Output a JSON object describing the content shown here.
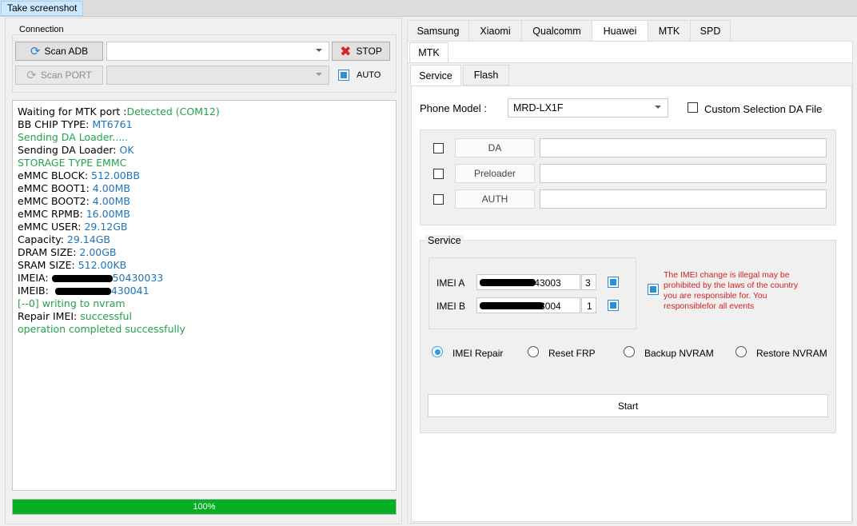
{
  "menubar": {
    "screenshot_button": "Take screenshot"
  },
  "connection": {
    "title": "Connection",
    "scan_adb": "Scan ADB",
    "stop": "STOP",
    "scan_port": "Scan PORT",
    "auto_label": "AUTO"
  },
  "log": [
    [
      {
        "t": "Waiting for MTK port :",
        "c": ""
      },
      {
        "t": "Detected (COM12)",
        "c": "green"
      }
    ],
    [
      {
        "t": "BB CHIP TYPE: ",
        "c": ""
      },
      {
        "t": "MT6761",
        "c": "blue"
      }
    ],
    [
      {
        "t": "Sending DA Loader.....",
        "c": "green"
      }
    ],
    [
      {
        "t": "Sending DA Loader: ",
        "c": ""
      },
      {
        "t": "OK",
        "c": "blue"
      }
    ],
    [
      {
        "t": "STORAGE TYPE EMMC",
        "c": "green"
      }
    ],
    [
      {
        "t": "eMMC BLOCK: ",
        "c": ""
      },
      {
        "t": "512.00BB",
        "c": "blue"
      }
    ],
    [
      {
        "t": "eMMC BOOT1: ",
        "c": ""
      },
      {
        "t": "4.00MB",
        "c": "blue"
      }
    ],
    [
      {
        "t": "eMMC BOOT2: ",
        "c": ""
      },
      {
        "t": "4.00MB",
        "c": "blue"
      }
    ],
    [
      {
        "t": "eMMC RPMB: ",
        "c": ""
      },
      {
        "t": "16.00MB",
        "c": "blue"
      }
    ],
    [
      {
        "t": "eMMC USER: ",
        "c": ""
      },
      {
        "t": "29.12GB",
        "c": "blue"
      }
    ],
    [
      {
        "t": "Capacity: ",
        "c": ""
      },
      {
        "t": "29.14GB",
        "c": "blue"
      }
    ],
    [
      {
        "t": "DRAM SIZE: ",
        "c": ""
      },
      {
        "t": "2.00GB",
        "c": "blue"
      }
    ],
    [
      {
        "t": "SRAM SIZE: ",
        "c": ""
      },
      {
        "t": "512.00KB",
        "c": "blue"
      }
    ],
    [
      {
        "t": "IMEIA:",
        "c": ""
      },
      {
        "t": "",
        "c": "redact"
      },
      {
        "t": "50430033",
        "c": "blue"
      }
    ],
    [
      {
        "t": "IMEIB: ",
        "c": ""
      },
      {
        "t": "",
        "c": "redact"
      },
      {
        "t": "430041",
        "c": "blue"
      }
    ],
    [
      {
        "t": "[--0] writing to nvram",
        "c": "green"
      }
    ],
    [
      {
        "t": "Repair IMEI: ",
        "c": ""
      },
      {
        "t": "successful",
        "c": "green"
      }
    ],
    [
      {
        "t": "operation completed successfully",
        "c": "green"
      }
    ]
  ],
  "progress": {
    "label": "100%",
    "value": 100
  },
  "brand_tabs": [
    "Samsung",
    "Xiaomi",
    "Qualcomm",
    "Huawei",
    "MTK",
    "SPD"
  ],
  "sub_tab": "MTK",
  "mode_tabs": [
    "Service",
    "Flash"
  ],
  "phone_model": {
    "label": "Phone Model :",
    "value": "MRD-LX1F"
  },
  "custom_da": {
    "label": "Custom Selection DA File"
  },
  "da_files": [
    {
      "button": "DA",
      "path": ""
    },
    {
      "button": "Preloader",
      "path": ""
    },
    {
      "button": "AUTH",
      "path": ""
    }
  ],
  "service": {
    "title": "Service",
    "imei_a": {
      "label": "IMEI A",
      "value": "5043003",
      "check_digit": "3"
    },
    "imei_b": {
      "label": "IMEI B",
      "value": "5043004",
      "check_digit": "1"
    },
    "warning": "The IMEI change is illegal may be prohibited by the laws of the country you are responsible for. You responsiblefor all events",
    "options": [
      "IMEI Repair",
      "Reset FRP",
      "Backup NVRAM",
      "Restore NVRAM"
    ],
    "selected_option": "IMEI Repair",
    "start": "Start"
  },
  "colors": {
    "accent": "#2b8fd8",
    "success": "#22a34a",
    "info": "#1f73b7",
    "progress": "#06b025",
    "warning": "#d42222"
  }
}
